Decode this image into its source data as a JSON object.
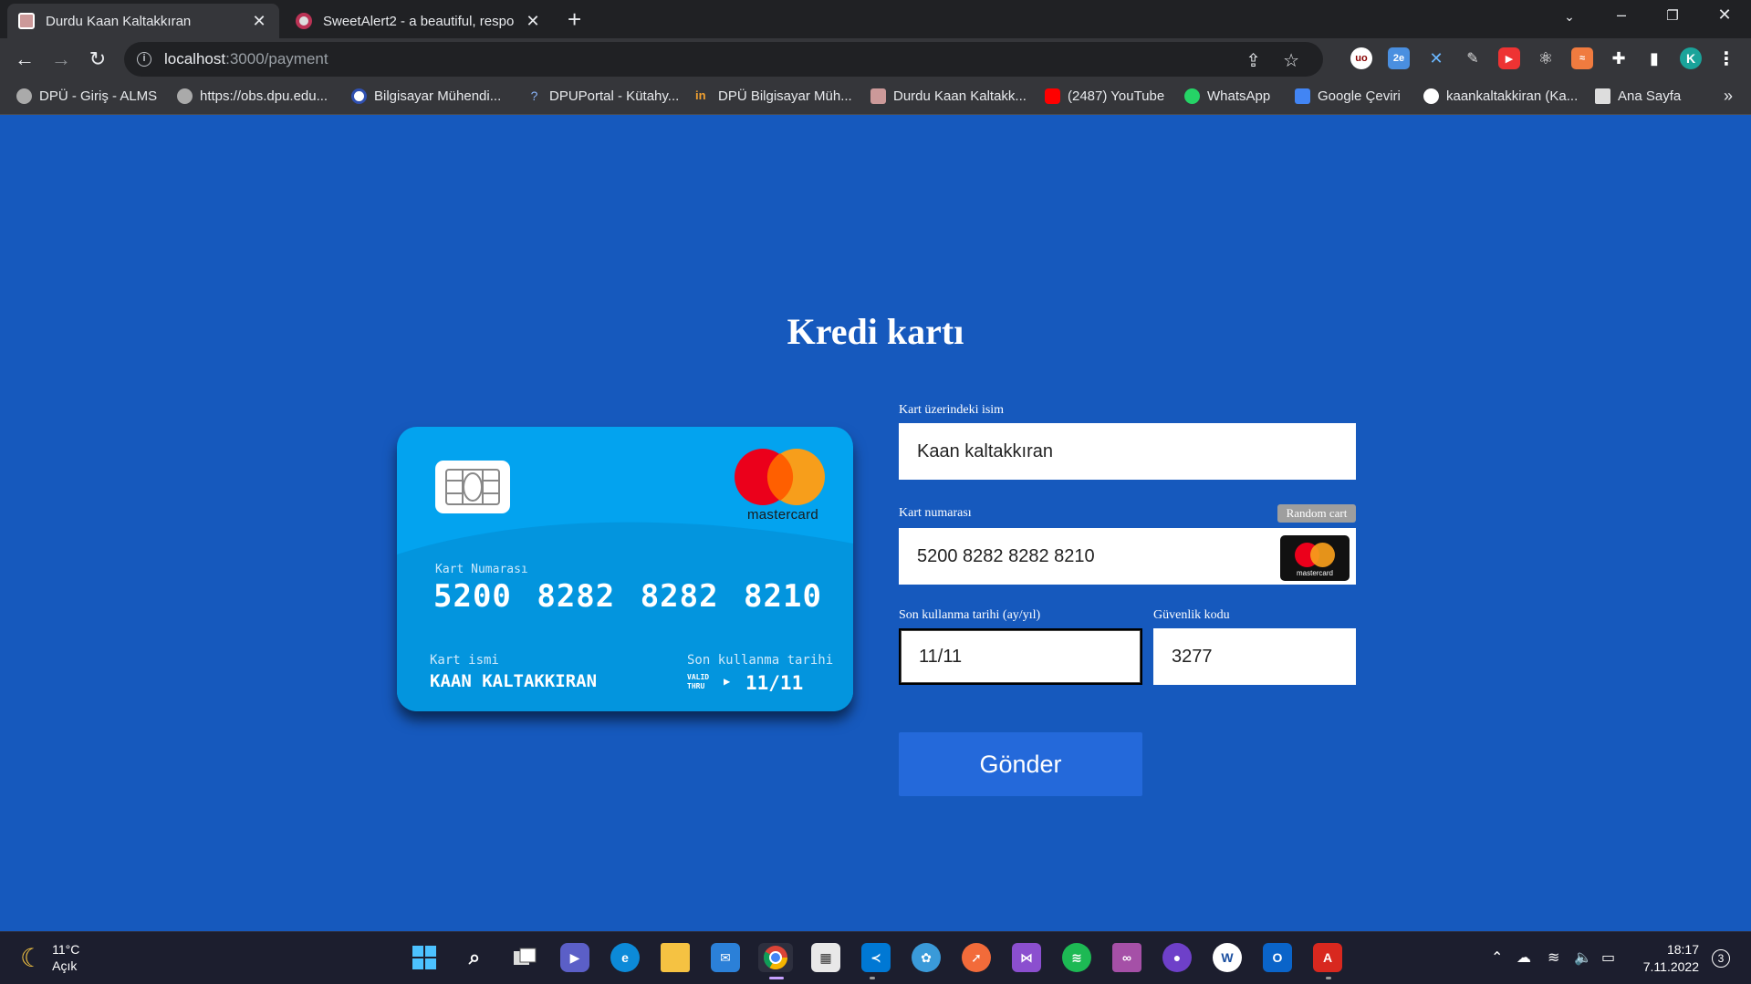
{
  "browser": {
    "tabs": [
      {
        "title": "Durdu Kaan Kaltakkıran",
        "close": "✕"
      },
      {
        "title": "SweetAlert2 - a beautiful, respon",
        "close": "✕"
      }
    ],
    "new_tab": "+",
    "address": {
      "host": "localhost",
      "path": ":3000/payment"
    },
    "bookmarks": [
      "DPÜ - Giriş - ALMS",
      "https://obs.dpu.edu...",
      "Bilgisayar Mühendi...",
      "DPUPortal - Kütahy...",
      "DPÜ Bilgisayar Müh...",
      "Durdu Kaan Kaltakk...",
      "(2487) YouTube",
      "WhatsApp",
      "Google Çeviri",
      "kaankaltakkiran (Ka...",
      "Ana Sayfa"
    ],
    "profile_initial": "K"
  },
  "page": {
    "title": "Kredi kartı",
    "card": {
      "number_label": "Kart Numarası",
      "number": "5200 8282 8282 8210",
      "name_label": "Kart ismi",
      "name": "KAAN KALTAKKIRAN",
      "expiry_label": "Son kullanma tarihi",
      "valid_thru": "VALID THRU",
      "expiry": "11/11",
      "brand": "mastercard"
    },
    "form": {
      "name_label": "Kart üzerindeki isim",
      "name_value": "Kaan kaltakkıran",
      "number_label": "Kart numarası",
      "random_button": "Random cart",
      "number_value": "5200 8282 8282 8210",
      "brand_small": "mastercard",
      "expiry_label": "Son kullanma tarihi (ay/yıl)",
      "expiry_value": "11/11",
      "cvv_label": "Güvenlik kodu",
      "cvv_value": "3277",
      "submit": "Gönder"
    }
  },
  "taskbar": {
    "weather_temp": "11°C",
    "weather_desc": "Açık",
    "time": "18:17",
    "date": "7.11.2022",
    "notifications": "3"
  },
  "colors": {
    "page_bg": "#1659bd",
    "card_bg": "#03a3ef",
    "submit_bg": "#2469da",
    "mc_red": "#eb001b",
    "mc_orange": "#f79e1b"
  }
}
